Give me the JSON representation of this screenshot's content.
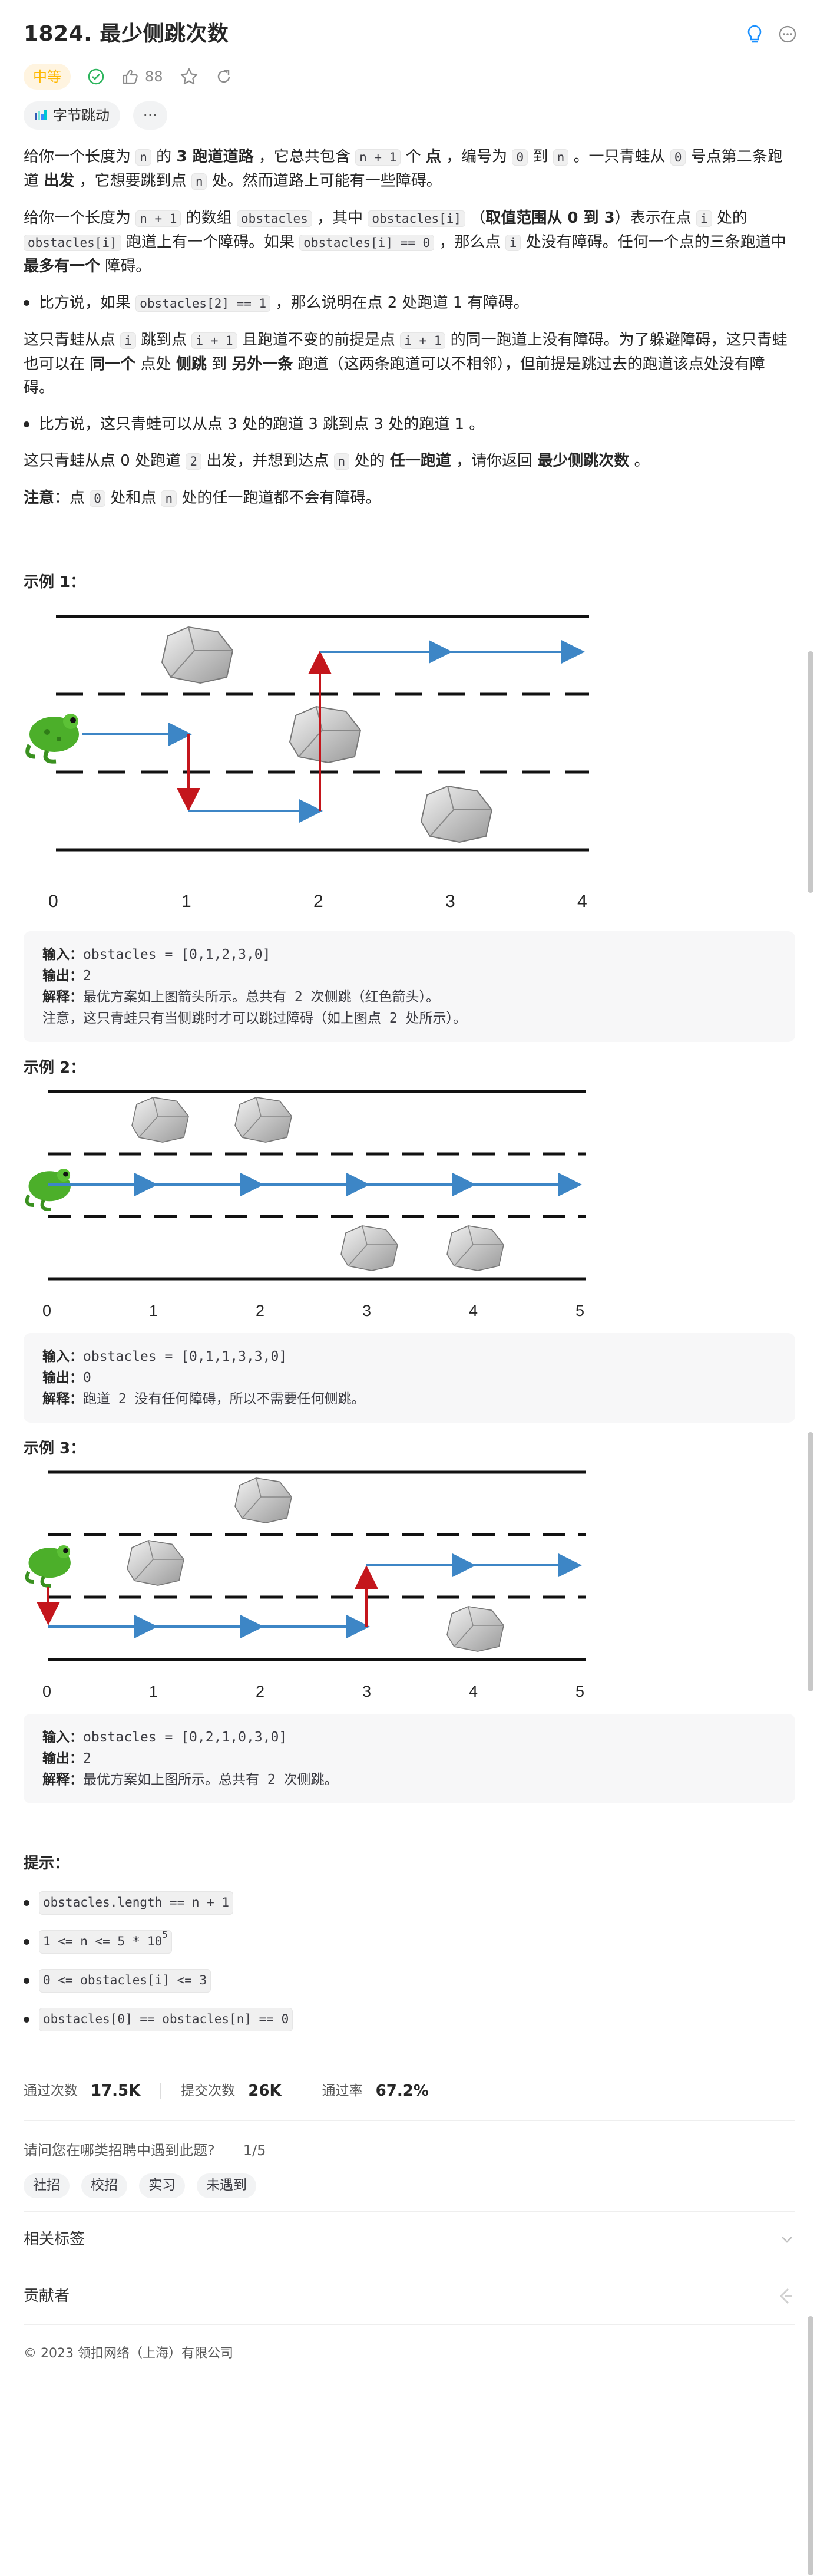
{
  "title": "1824. 最少侧跳次数",
  "difficulty": "中等",
  "likes": "88",
  "company": "字节跳动",
  "more": "···",
  "desc": {
    "p1": [
      "给你一个长度为 ",
      "n",
      " 的 ",
      "3 跑道道路",
      " ，它总共包含 ",
      "n + 1",
      " 个 ",
      "点",
      " ，编号为 ",
      "0",
      " 到 ",
      "n",
      " 。一只青蛙从 ",
      "0",
      " 号点第二条跑道 ",
      "出发",
      " ，它想要跳到点 ",
      "n",
      " 处。然而道路上可能有一些障碍。"
    ],
    "p2": [
      "给你一个长度为 ",
      "n + 1",
      " 的数组 ",
      "obstacles",
      " ，其中 ",
      "obstacles[i]",
      " （",
      "取值范围从 0 到 3",
      "）表示在点 ",
      "i",
      " 处的 ",
      "obstacles[i]",
      " 跑道上有一个障碍。如果 ",
      "obstacles[i] == 0",
      " ，那么点 ",
      "i",
      " 处没有障碍。任何一个点的三条跑道中 ",
      "最多有一个",
      " 障碍。"
    ],
    "b1": [
      "比方说，如果 ",
      "obstacles[2] == 1",
      " ，那么说明在点 2 处跑道 1 有障碍。"
    ],
    "p3": [
      "这只青蛙从点 ",
      "i",
      " 跳到点 ",
      "i + 1",
      " 且跑道不变的前提是点 ",
      "i + 1",
      " 的同一跑道上没有障碍。为了躲避障碍，这只青蛙也可以在 ",
      "同一个",
      " 点处 ",
      "侧跳",
      " 到 ",
      "另外一条",
      " 跑道（这两条跑道可以不相邻），但前提是跳过去的跑道该点处没有障碍。"
    ],
    "b2": "比方说，这只青蛙可以从点 3 处的跑道 3 跳到点 3 处的跑道 1 。",
    "p4": [
      "这只青蛙从点 0 处跑道 ",
      "2",
      " 出发，并想到达点 ",
      "n",
      " 处的 ",
      "任一跑道",
      " ，请你返回 ",
      "最少侧跳次数",
      " 。"
    ],
    "note": [
      "注意",
      "：点 ",
      "0",
      " 处和点 ",
      "n",
      " 处的任一跑道都不会有障碍。"
    ]
  },
  "examples": [
    {
      "heading": "示例 1：",
      "input_label": "输入：",
      "input": "obstacles = [0,1,2,3,0]",
      "output_label": "输出：",
      "output": "2",
      "explain_label": "解释：",
      "explain": "最优方案如上图箭头所示。总共有 2 次侧跳（红色箭头）。",
      "extra": "注意，这只青蛙只有当侧跳时才可以跳过障碍（如上图点 2 处所示）。",
      "ticks": [
        "0",
        "1",
        "2",
        "3",
        "4"
      ]
    },
    {
      "heading": "示例 2：",
      "input_label": "输入：",
      "input": "obstacles = [0,1,1,3,3,0]",
      "output_label": "输出：",
      "output": "0",
      "explain_label": "解释：",
      "explain": "跑道 2 没有任何障碍，所以不需要任何侧跳。",
      "ticks": [
        "0",
        "1",
        "2",
        "3",
        "4",
        "5"
      ]
    },
    {
      "heading": "示例 3：",
      "input_label": "输入：",
      "input": "obstacles = [0,2,1,0,3,0]",
      "output_label": "输出：",
      "output": "2",
      "explain_label": "解释：",
      "explain": "最优方案如上图所示。总共有 2 次侧跳。",
      "ticks": [
        "0",
        "1",
        "2",
        "3",
        "4",
        "5"
      ]
    }
  ],
  "hints": {
    "heading": "提示：",
    "h1": "obstacles.length == n + 1",
    "h2": "1 <= n <= 5 * 10",
    "h2_sup": "5",
    "h3": "0 <= obstacles[i] <= 3",
    "h4": "obstacles[0] == obstacles[n] == 0"
  },
  "stats": {
    "accepted_label": "通过次数",
    "accepted": "17.5K",
    "submissions_label": "提交次数",
    "submissions": "26K",
    "rate_label": "通过率",
    "rate": "67.2%"
  },
  "survey": {
    "question": "请问您在哪类招聘中遇到此题?",
    "page": "1/5",
    "options": [
      "社招",
      "校招",
      "实习",
      "未遇到"
    ]
  },
  "related_tags": "相关标签",
  "contributors": "贡献者",
  "footer": "© 2023 领扣网络（上海）有限公司",
  "colors": {
    "difficulty_text": "#ffb800",
    "difficulty_bg": "#fff4e0",
    "accent_blue": "#3d86c6",
    "jump_red": "#c4161c",
    "solved_green": "#2db55d",
    "hint_blue": "#1a90ff"
  }
}
